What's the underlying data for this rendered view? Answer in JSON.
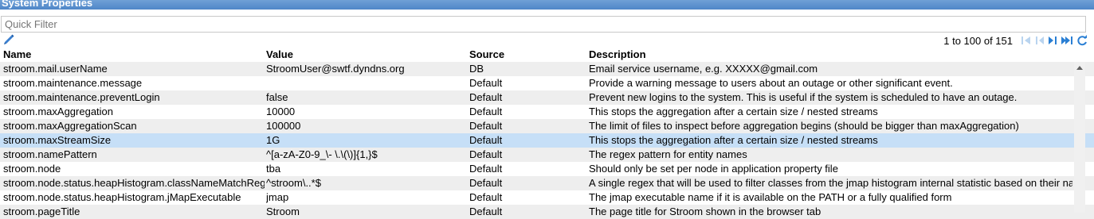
{
  "title": "System Properties",
  "filter": {
    "placeholder": "Quick Filter",
    "value": ""
  },
  "pager": {
    "range_text": "1 to 100 of 151"
  },
  "colors": {
    "selected_row": "#c6dff7",
    "alt_row": "#eeeeee",
    "pager_icons": "#2a7fd4"
  },
  "icons": [
    "edit-pencil-icon",
    "first-page-icon",
    "previous-page-icon",
    "next-page-icon",
    "last-page-icon",
    "refresh-icon"
  ],
  "columns": {
    "name": "Name",
    "value": "Value",
    "source": "Source",
    "description": "Description"
  },
  "rows": [
    {
      "name": "stroom.mail.userName",
      "value": "StroomUser@swtf.dyndns.org",
      "source": "DB",
      "description": "Email service username, e.g. XXXXX@gmail.com"
    },
    {
      "name": "stroom.maintenance.message",
      "value": "",
      "source": "Default",
      "description": "Provide a warning message to users about an outage or other significant event."
    },
    {
      "name": "stroom.maintenance.preventLogin",
      "value": "false",
      "source": "Default",
      "description": "Prevent new logins to the system. This is useful if the system is scheduled to have an outage."
    },
    {
      "name": "stroom.maxAggregation",
      "value": "10000",
      "source": "Default",
      "description": "This stops the aggregation after a certain size / nested streams"
    },
    {
      "name": "stroom.maxAggregationScan",
      "value": "100000",
      "source": "Default",
      "description": "The limit of files to inspect before aggregation begins (should be bigger than maxAggregation)"
    },
    {
      "name": "stroom.maxStreamSize",
      "value": "1G",
      "source": "Default",
      "description": "This stops the aggregation after a certain size / nested streams"
    },
    {
      "name": "stroom.namePattern",
      "value": "^[a-zA-Z0-9_\\- \\.\\(\\)]{1,}$",
      "source": "Default",
      "description": "The regex pattern for entity names"
    },
    {
      "name": "stroom.node",
      "value": "tba",
      "source": "Default",
      "description": "Should only be set per node in application property file"
    },
    {
      "name": "stroom.node.status.heapHistogram.classNameMatchRegex",
      "value": "^stroom\\..*$",
      "source": "Default",
      "description": "A single regex that will be used to filter classes from the jmap histogram internal statistic based on their name"
    },
    {
      "name": "stroom.node.status.heapHistogram.jMapExecutable",
      "value": "jmap",
      "source": "Default",
      "description": "The jmap executable name if it is available on the PATH or a fully qualified form"
    },
    {
      "name": "stroom.pageTitle",
      "value": "Stroom",
      "source": "Default",
      "description": "The page title for Stroom shown in the browser tab"
    }
  ]
}
